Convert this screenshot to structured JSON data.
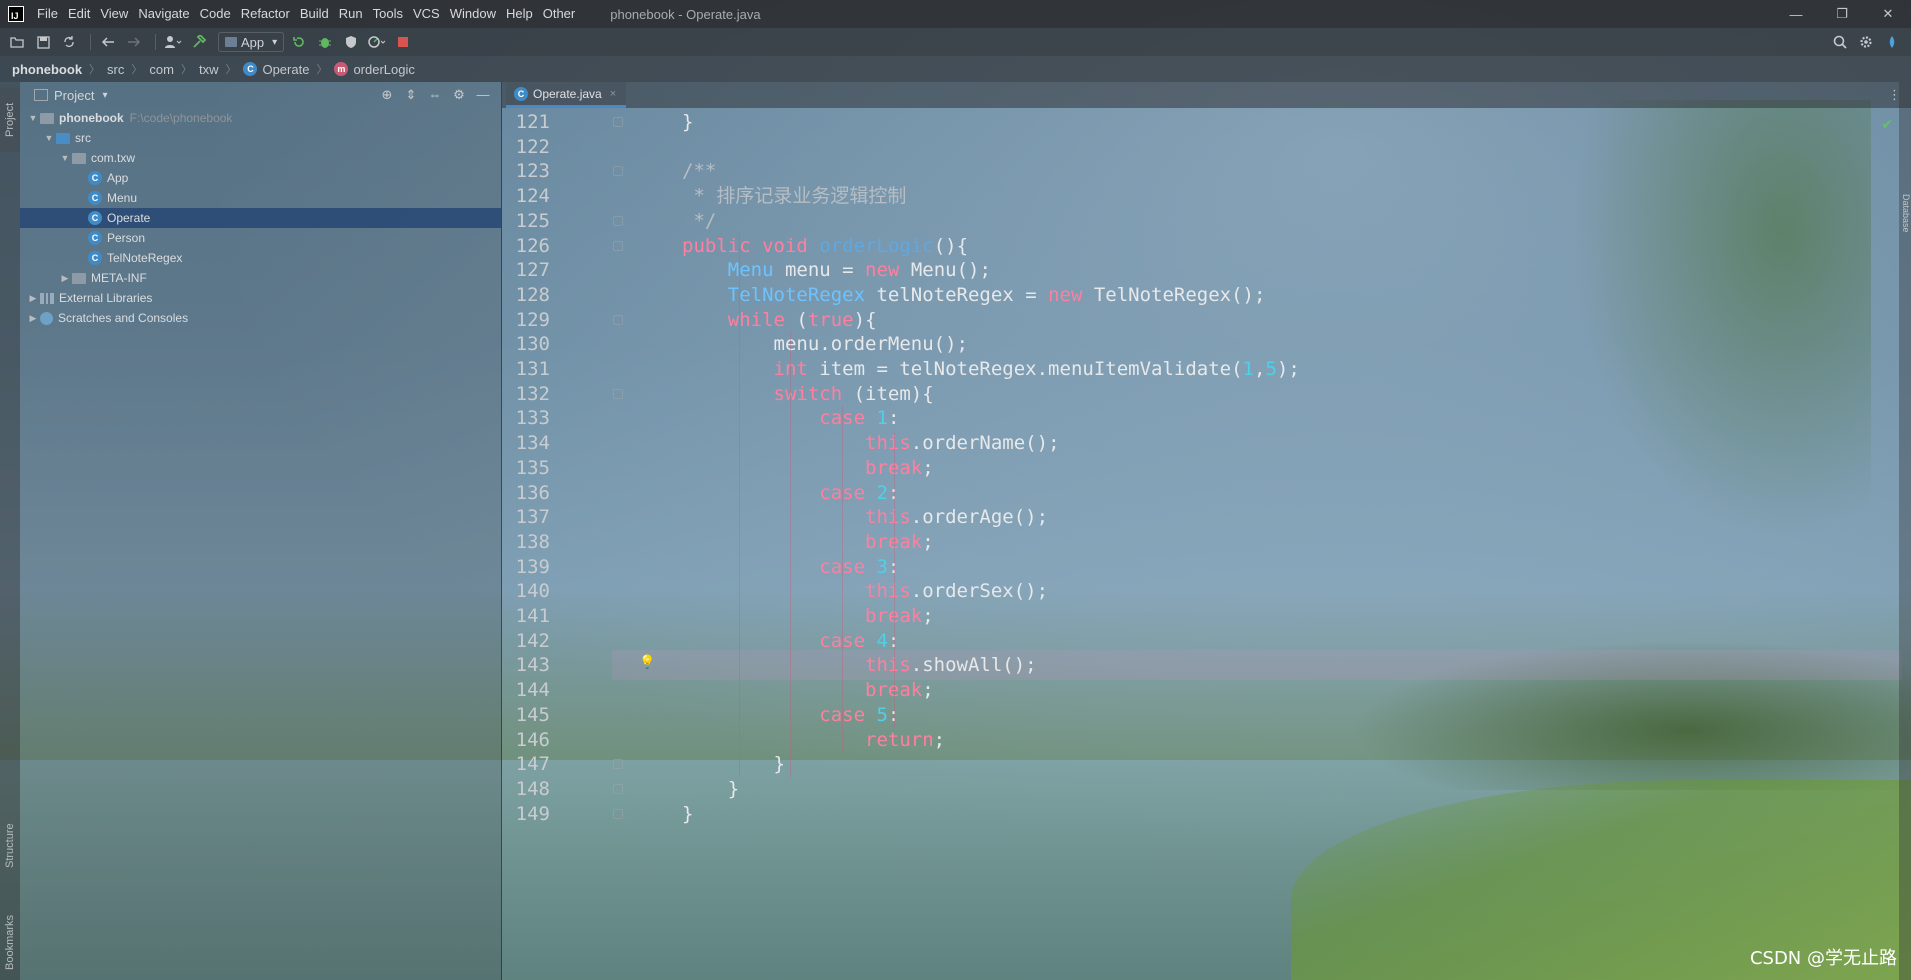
{
  "window": {
    "title": "phonebook - Operate.java",
    "menu": [
      "File",
      "Edit",
      "View",
      "Navigate",
      "Code",
      "Refactor",
      "Build",
      "Run",
      "Tools",
      "VCS",
      "Window",
      "Help",
      "Other"
    ],
    "logo_text": "IJ",
    "minimize": "—",
    "restore": "❐",
    "close": "✕"
  },
  "toolbar": {
    "run_config": "App",
    "dropdown_arrow": "▾"
  },
  "breadcrumbs": [
    "phonebook",
    "src",
    "com",
    "txw",
    "Operate",
    "orderLogic"
  ],
  "breadcrumb_sep": "〉",
  "left_strip": {
    "project": "Project",
    "structure": "Structure",
    "bookmarks": "Bookmarks"
  },
  "project_panel": {
    "title": "Project",
    "tree": [
      {
        "label": "phonebook",
        "hint": "F:\\code\\phonebook",
        "level": 0,
        "kind": "module",
        "expanded": true
      },
      {
        "label": "src",
        "level": 1,
        "kind": "folder",
        "expanded": true
      },
      {
        "label": "com.txw",
        "level": 2,
        "kind": "package",
        "expanded": true
      },
      {
        "label": "App",
        "level": 3,
        "kind": "class"
      },
      {
        "label": "Menu",
        "level": 3,
        "kind": "class"
      },
      {
        "label": "Operate",
        "level": 3,
        "kind": "class",
        "selected": true
      },
      {
        "label": "Person",
        "level": 3,
        "kind": "class"
      },
      {
        "label": "TelNoteRegex",
        "level": 3,
        "kind": "class"
      },
      {
        "label": "META-INF",
        "level": 2,
        "kind": "folder",
        "expanded": false
      },
      {
        "label": "External Libraries",
        "level": 0,
        "kind": "library",
        "expanded": false
      },
      {
        "label": "Scratches and Consoles",
        "level": 0,
        "kind": "scratch",
        "expanded": false
      }
    ]
  },
  "editor": {
    "tab_label": "Operate.java",
    "tab_close": "×",
    "right_tab": "Database",
    "caret_line": 143,
    "lines": [
      {
        "n": "121",
        "html": "}"
      },
      {
        "n": "122",
        "html": ""
      },
      {
        "n": "123",
        "html": "<span class='cm'>/**</span>"
      },
      {
        "n": "124",
        "html": "<span class='cm'> * 排序记录业务逻辑控制</span>"
      },
      {
        "n": "125",
        "html": "<span class='cm'> */</span>"
      },
      {
        "n": "126",
        "html": "<span class='kw'>public</span> <span class='kw'>void</span> <span class='fn'>orderLogic</span>(){"
      },
      {
        "n": "127",
        "html": "    <span class='ty'>Menu</span> menu = <span class='kw'>new</span> Menu();"
      },
      {
        "n": "128",
        "html": "    <span class='ty'>TelNoteRegex</span> telNoteRegex = <span class='kw'>new</span> TelNoteRegex();"
      },
      {
        "n": "129",
        "html": "    <span class='kw'>while</span> (<span class='kw'>true</span>){"
      },
      {
        "n": "130",
        "html": "        menu.orderMenu();"
      },
      {
        "n": "131",
        "html": "        <span class='kw'>int</span> item = telNoteRegex.menuItemValidate(<span class='num'>1</span>,<span class='num'>5</span>);"
      },
      {
        "n": "132",
        "html": "        <span class='kw'>switch</span> (item){"
      },
      {
        "n": "133",
        "html": "            <span class='kw'>case</span> <span class='num'>1</span>:"
      },
      {
        "n": "134",
        "html": "                <span class='kw'>this</span>.orderName();"
      },
      {
        "n": "135",
        "html": "                <span class='kw'>break</span>;"
      },
      {
        "n": "136",
        "html": "            <span class='kw'>case</span> <span class='num'>2</span>:"
      },
      {
        "n": "137",
        "html": "                <span class='kw'>this</span>.orderAge();"
      },
      {
        "n": "138",
        "html": "                <span class='kw'>break</span>;"
      },
      {
        "n": "139",
        "html": "            <span class='kw'>case</span> <span class='num'>3</span>:"
      },
      {
        "n": "140",
        "html": "                <span class='kw'>this</span>.orderSex();"
      },
      {
        "n": "141",
        "html": "                <span class='kw'>break</span>;"
      },
      {
        "n": "142",
        "html": "            <span class='kw'>case</span> <span class='num'>4</span>:"
      },
      {
        "n": "143",
        "html": "                <span class='kw'>this</span>.showAll();"
      },
      {
        "n": "144",
        "html": "                <span class='kw'>break</span>;"
      },
      {
        "n": "145",
        "html": "            <span class='kw'>case</span> <span class='num'>5</span>:"
      },
      {
        "n": "146",
        "html": "                <span class='kw'>return</span>;"
      },
      {
        "n": "147",
        "html": "        }"
      },
      {
        "n": "148",
        "html": "    }"
      },
      {
        "n": "149",
        "html": "}"
      }
    ]
  },
  "watermark": "CSDN @学无止路",
  "colors": {
    "accent": "#4a88c7",
    "keyword": "#ff7f9e",
    "number": "#4fd0e8",
    "type": "#6ec3ff"
  }
}
